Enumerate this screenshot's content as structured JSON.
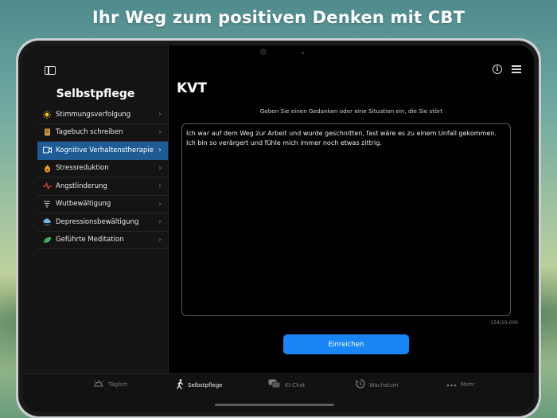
{
  "headline": "Ihr Weg zum positiven Denken mit CBT",
  "sidebar": {
    "title": "Selbstpflege",
    "items": [
      {
        "label": "Stimmungsverfolgung",
        "icon": "sun-icon",
        "color": "#f5c518"
      },
      {
        "label": "Tagebuch schreiben",
        "icon": "notebook-icon",
        "color": "#c9974a"
      },
      {
        "label": "Kognitive Verhaltenstherapie",
        "icon": "cbt-icon",
        "color": "#ffffff",
        "active": true
      },
      {
        "label": "Stressreduktion",
        "icon": "flame-icon",
        "color": "#f0a020"
      },
      {
        "label": "Angstlinderung",
        "icon": "pulse-icon",
        "color": "#e5453a"
      },
      {
        "label": "Wutbewältigung",
        "icon": "storm-icon",
        "color": "#c7c7c7"
      },
      {
        "label": "Depressionsbewältigung",
        "icon": "rain-cloud-icon",
        "color": "#6fb7e8"
      },
      {
        "label": "Geführte Meditation",
        "icon": "leaf-icon",
        "color": "#45c46a"
      }
    ]
  },
  "main": {
    "title": "KVT",
    "prompt": "Geben Sie einen Gedanken oder eine Situation ein, die Sie stört",
    "text_value": "Ich war auf dem Weg zur Arbeit und wurde geschnitten, fast wäre es zu einem Unfall gekommen. Ich bin so verärgert und fühle mich immer noch etwas zittrig.",
    "counter": "154/10,000",
    "submit_label": "Einreichen"
  },
  "tabbar": {
    "tabs": [
      {
        "label": "Täglich",
        "icon": "sunrise-icon"
      },
      {
        "label": "Selbstpflege",
        "icon": "walking-icon",
        "active": true
      },
      {
        "label": "KI-Chat",
        "icon": "chat-bubbles-icon"
      },
      {
        "label": "Wachstum",
        "icon": "growth-icon"
      },
      {
        "label": "Mehr",
        "icon": "more-dots-icon"
      }
    ]
  },
  "colors": {
    "accent": "#1a86f5",
    "active_row": "#1f5c95"
  }
}
